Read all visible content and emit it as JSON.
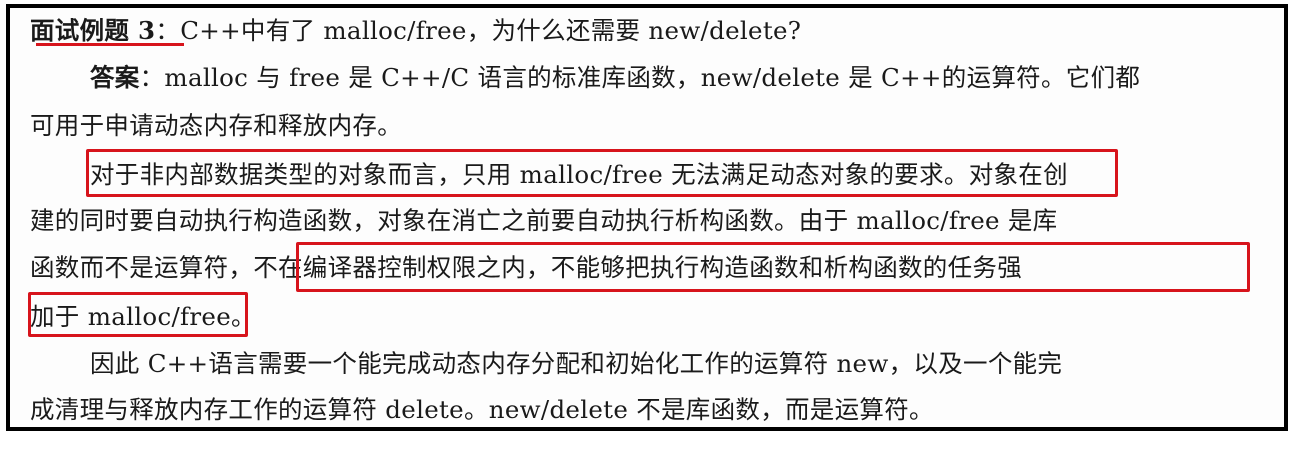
{
  "question": {
    "label": "面试例题 3",
    "sep": "：",
    "text": "C++中有了 malloc/free，为什么还需要 new/delete?"
  },
  "answer": {
    "label": "答案",
    "sep": "：",
    "line1": "malloc 与 free 是 C++/C 语言的标准库函数，new/delete 是 C++的运算符。它们都",
    "line2": "可用于申请动态内存和释放内存。"
  },
  "para2": {
    "line1_highlight": "对于非内部数据类型的对象而言，只用 malloc/free 无法满足动态对象的要求。",
    "line1_rest": "对象在创",
    "line2": "建的同时要自动执行构造函数，对象在消亡之前要自动执行析构函数。由于 malloc/free 是库",
    "line3_plain": "函数而不是运算符，",
    "line3_highlight": "不在编译器控制权限之内，不能够把执行构造函数和析构函数的任务强",
    "line4_highlight": "加于 malloc/free",
    "line4_end": "。"
  },
  "para3": {
    "line1": "因此 C++语言需要一个能完成动态内存分配和初始化工作的运算符 new，以及一个能完",
    "line2": "成清理与释放内存工作的运算符 delete。new/delete 不是库函数，而是运算符。"
  },
  "colors": {
    "highlight_border": "#d7141c",
    "frame_border": "#000000"
  }
}
